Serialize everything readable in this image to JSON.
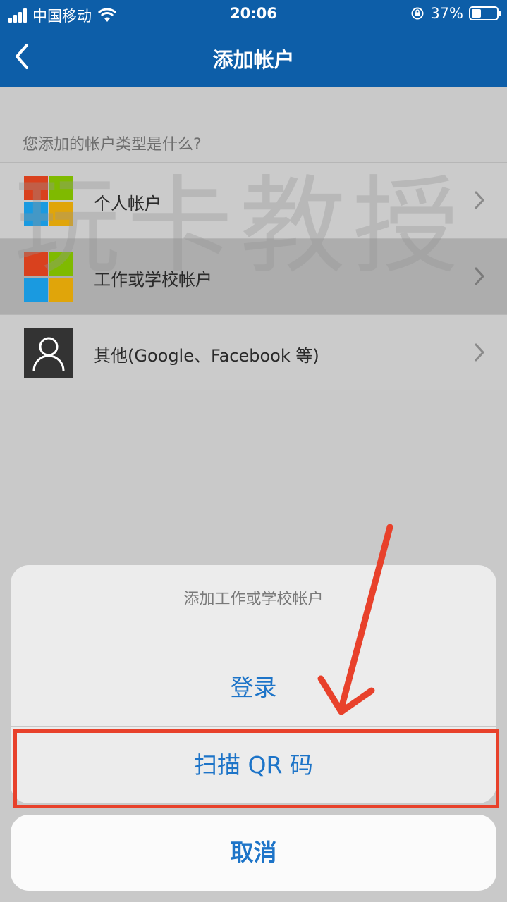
{
  "status_bar": {
    "carrier": "中国移动",
    "time": "20:06",
    "battery_percent": "37%",
    "battery_level": 0.37
  },
  "navbar": {
    "title": "添加帐户",
    "back_icon": "chevron-left-icon"
  },
  "watermark": "玩卡教授",
  "question": "您添加的帐户类型是什么?",
  "account_types": [
    {
      "label": "个人帐户",
      "icon": "microsoft-logo-icon"
    },
    {
      "label": "工作或学校帐户",
      "icon": "microsoft-logo-icon",
      "selected": true
    },
    {
      "label": "其他(Google、Facebook 等)",
      "icon": "person-icon"
    }
  ],
  "action_sheet": {
    "title": "添加工作或学校帐户",
    "actions": [
      {
        "label": "登录"
      },
      {
        "label": "扫描 QR 码",
        "highlighted": true
      }
    ],
    "cancel_label": "取消"
  },
  "colors": {
    "nav_blue": "#0d5ea8",
    "action_blue": "#1d74c8",
    "annotation_red": "#e8412b",
    "ms_red": "#d9411e",
    "ms_green": "#7fba00",
    "ms_blue": "#1a9ae0",
    "ms_yellow": "#e0a50a"
  }
}
